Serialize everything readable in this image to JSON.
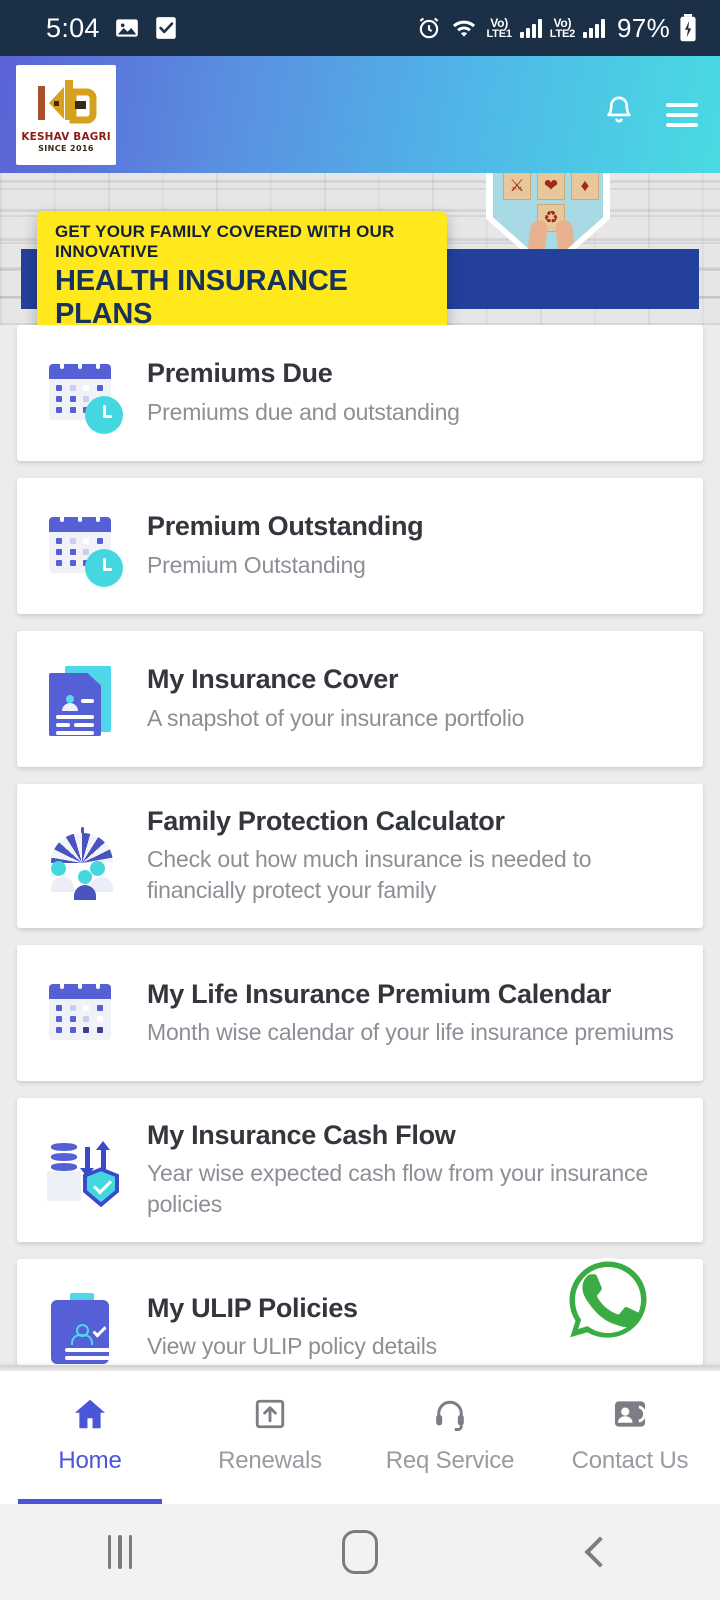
{
  "statusbar": {
    "time": "5:04",
    "icons_left": [
      "image-icon",
      "checkbox-icon"
    ],
    "alarm": "alarm-icon",
    "wifi": "wifi-icon",
    "sim1_label_top": "Vo)",
    "sim1_label_bottom": "LTE1",
    "sim2_label_top": "Vo)",
    "sim2_label_bottom": "LTE2",
    "battery_percent": "97%"
  },
  "header": {
    "logo": {
      "monogram": "KB",
      "name": "KESHAV BAGRI",
      "since": "SINCE 2016"
    },
    "notification_icon": "bell-icon",
    "menu_icon": "hamburger-icon"
  },
  "banner": {
    "line1": "GET YOUR FAMILY COVERED WITH OUR INNOVATIVE",
    "line2": "HEALTH INSURANCE PLANS",
    "highlight_color": "#ffe81b",
    "band_color": "#23419b",
    "shield_icons": [
      "pills-icon",
      "heart-icon",
      "stethoscope-icon",
      "medicine-bottle-icon"
    ]
  },
  "cards": [
    {
      "icon": "calendar-clock-icon",
      "title": "Premiums Due",
      "desc": "Premiums due and outstanding"
    },
    {
      "icon": "calendar-clock-icon",
      "title": "Premium Outstanding",
      "desc": "Premium Outstanding"
    },
    {
      "icon": "document-profile-icon",
      "title": "My Insurance Cover",
      "desc": "A snapshot of your insurance portfolio"
    },
    {
      "icon": "umbrella-family-icon",
      "title": "Family Protection Calculator",
      "desc": "Check out how much insurance is needed to financially protect your family"
    },
    {
      "icon": "calendar-icon",
      "title": "My Life Insurance Premium Calendar",
      "desc": "Month wise calendar of your life insurance premiums"
    },
    {
      "icon": "cash-flow-shield-icon",
      "title": "My Insurance Cash Flow",
      "desc": "Year wise expected cash flow from your insurance policies"
    },
    {
      "icon": "clipboard-person-check-icon",
      "title": "My ULIP Policies",
      "desc": "View your ULIP policy details"
    }
  ],
  "fab": {
    "icon": "whatsapp-icon",
    "color": "#3bab43"
  },
  "bottom_nav": {
    "accent_color": "#4a55d8",
    "items": [
      {
        "label": "Home",
        "icon": "home-icon",
        "active": true
      },
      {
        "label": "Renewals",
        "icon": "upload-box-icon",
        "active": false
      },
      {
        "label": "Req Service",
        "icon": "headset-icon",
        "active": false
      },
      {
        "label": "Contact Us",
        "icon": "contacts-icon",
        "active": false
      }
    ]
  },
  "android_nav": {
    "recents": "recents-icon",
    "home": "home-circle-icon",
    "back": "back-icon"
  }
}
